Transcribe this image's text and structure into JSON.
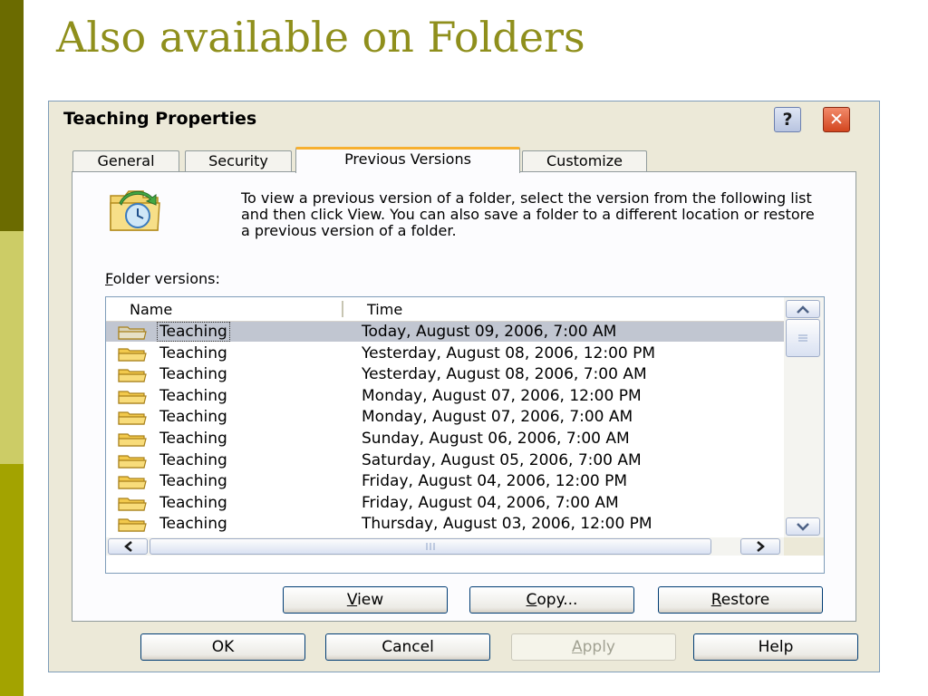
{
  "slide": {
    "title": "Also available on Folders"
  },
  "dialog": {
    "title": "Teaching Properties",
    "help_button": "?",
    "close_button": "✕",
    "tabs": [
      {
        "label": "General"
      },
      {
        "label": "Security"
      },
      {
        "label": "Previous Versions",
        "active": true
      },
      {
        "label": "Customize"
      }
    ],
    "description": "To view a previous version of a folder, select the version from the following list and then click View. You can also save a folder to a different location or restore a previous version of a folder.",
    "list_label": {
      "accel": "F",
      "rest": "older versions:"
    },
    "columns": {
      "name": "Name",
      "time": "Time"
    },
    "versions": [
      {
        "name": "Teaching",
        "time": "Today, August 09, 2006, 7:00 AM",
        "selected": true
      },
      {
        "name": "Teaching",
        "time": "Yesterday, August 08, 2006, 12:00 PM"
      },
      {
        "name": "Teaching",
        "time": "Yesterday, August 08, 2006, 7:00 AM"
      },
      {
        "name": "Teaching",
        "time": "Monday, August 07, 2006, 12:00 PM"
      },
      {
        "name": "Teaching",
        "time": "Monday, August 07, 2006, 7:00 AM"
      },
      {
        "name": "Teaching",
        "time": "Sunday, August 06, 2006, 7:00 AM"
      },
      {
        "name": "Teaching",
        "time": "Saturday, August 05, 2006, 7:00 AM"
      },
      {
        "name": "Teaching",
        "time": "Friday, August 04, 2006, 12:00 PM"
      },
      {
        "name": "Teaching",
        "time": "Friday, August 04, 2006, 7:00 AM"
      },
      {
        "name": "Teaching",
        "time": "Thursday, August 03, 2006, 12:00 PM"
      }
    ],
    "buttons": {
      "view": {
        "accel": "V",
        "rest": "iew"
      },
      "copy": {
        "accel": "C",
        "rest": "opy..."
      },
      "restore": {
        "accel": "R",
        "rest": "estore"
      },
      "ok": "OK",
      "cancel": "Cancel",
      "apply": {
        "accel": "A",
        "rest": "pply"
      },
      "help": "Help"
    },
    "colors": {
      "tab_accent": "#f7b030",
      "selection": "#c1c6d1",
      "folder_yellow": "#f2c94c"
    }
  }
}
